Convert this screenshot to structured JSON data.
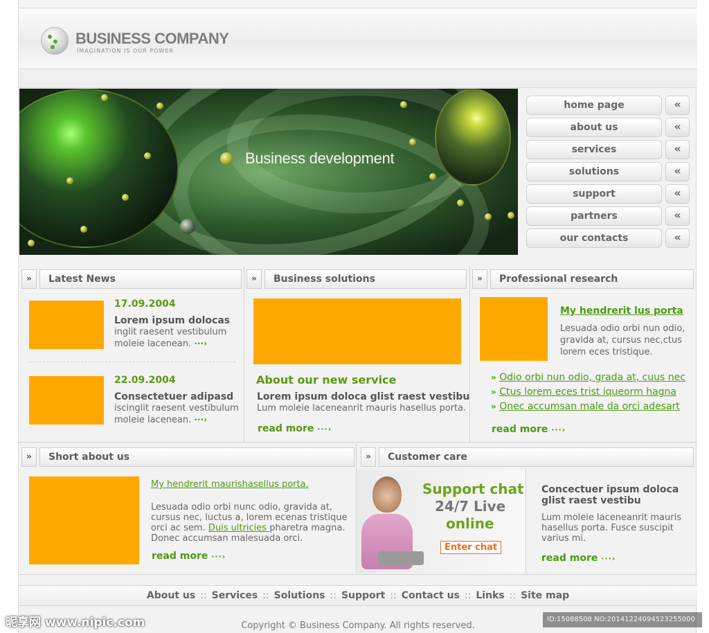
{
  "header": {
    "company_name": "BUSINESS COMPANY",
    "tagline": "IMAGINATION IS OUR POWER"
  },
  "banner": {
    "text": "Business development"
  },
  "nav": {
    "items": [
      {
        "label": "home page",
        "arrow": "«"
      },
      {
        "label": "about us",
        "arrow": "«"
      },
      {
        "label": "services",
        "arrow": "«"
      },
      {
        "label": "solutions",
        "arrow": "«"
      },
      {
        "label": "support",
        "arrow": "«"
      },
      {
        "label": "partners",
        "arrow": "«"
      },
      {
        "label": "our contacts",
        "arrow": "«"
      }
    ]
  },
  "section_arrow": "»",
  "latest_news": {
    "title": "Latest News",
    "items": [
      {
        "date": "17.09.2004",
        "heading": "Lorem ipsum dolocas",
        "line1": "inglit raesent vestibulum",
        "line2": "moleie lacenean.",
        "dots": "···›"
      },
      {
        "date": "22.09.2004",
        "heading": "Consectetuer adipasd",
        "line1": "iscinglit raesent vestibulum",
        "line2": "moleie lacenean.",
        "dots": "···›"
      }
    ]
  },
  "business_solutions": {
    "title": "Business solutions",
    "headline": "About our new service",
    "bold_line": "Lorem ipsum doloca glist raest vestibu",
    "line": "Lum moleie laceneanrit mauris hasellus porta.",
    "read_more": "read more",
    "dots": "···›"
  },
  "professional_research": {
    "title": "Professional research",
    "link_title": "My hendrerit lus porta",
    "text_lines": [
      "Lesuada odio orbi nun odio,",
      "gravida at, cursus nec,ctus",
      "lorem eces tristique."
    ],
    "bullet": "»",
    "links": [
      "Odio orbi nun odio, grada at, cuus nec",
      "Ctus lorem eces trist iqueorm hagna",
      "Onec accumsan male da orci adesart"
    ],
    "read_more": "read more",
    "dots": "···›"
  },
  "short_about": {
    "title": "Short about us",
    "link_title": "My hendrerit maurishasellus porta.",
    "line1": "Lesuada odio orbi nunc odio, gravida at,",
    "line2": "cursus nec, luctus a, lorem ecenas tristique",
    "line3_pre": "orci ac sem. ",
    "line3_link": "Duis ultricies ",
    "line3_post": "pharetra magna.",
    "line4": "Donec accumsan malesuada orci.",
    "read_more": "read more",
    "dots": "···›"
  },
  "customer_care": {
    "title": "Customer care",
    "chat_line1": "Support chat",
    "chat_line2": "24/7 Live",
    "chat_line3": "online",
    "enter_chat": "Enter chat",
    "heading_line1": "Concectuer ipsum doloca",
    "heading_line2": "glist raest vestibu",
    "text_lines": [
      "Lum moleie laceneanrit mauris",
      "hasellus porta. Fusce suscipit",
      "varius mi."
    ],
    "read_more": "read more",
    "dots": "···›"
  },
  "footer": {
    "links": [
      "About us",
      "Services",
      "Solutions",
      "Support",
      "Contact us",
      "Links",
      "Site map"
    ],
    "separator": "::",
    "copyright": "Copyright © Business Company. All rights reserved."
  },
  "watermark": {
    "left": "昵享网 www.nipic.com",
    "right": "ID:15088508 NO:20141224094523255000"
  },
  "colors": {
    "accent_green": "#4d9a12",
    "placeholder_orange": "#ffa800",
    "chat_green": "#6aa51d",
    "enter_chat_orange": "#f06a1a"
  }
}
